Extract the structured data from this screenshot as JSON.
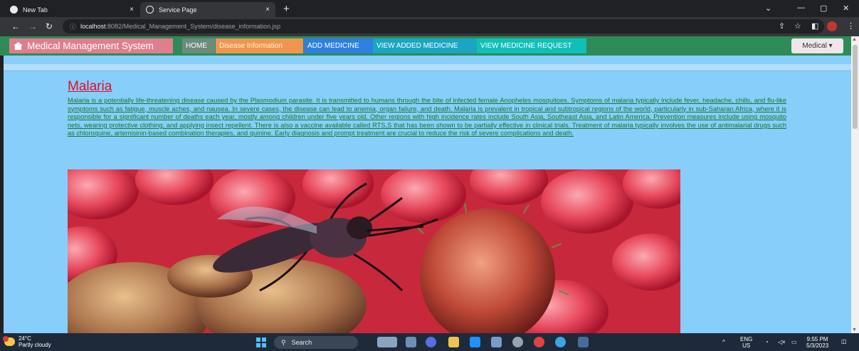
{
  "browser": {
    "tabs": [
      {
        "label": "New Tab"
      },
      {
        "label": "Service Page"
      }
    ],
    "new_tab_glyph": "+",
    "close_glyph": "×",
    "url_host": "localhost",
    "url_rest": ":8082/Medical_Management_System/disease_information.jsp"
  },
  "app": {
    "brand": "Medical Management System",
    "nav": [
      "HOME",
      "Disease Information",
      "ADD MEDICINE",
      "VIEW ADDED MEDICINE",
      "VIEW MEDICINE REQUEST"
    ],
    "dropdown": "Medical ▾"
  },
  "article": {
    "title": "Malaria",
    "body": "Malaria is a potentially life-threatening disease caused by the Plasmodium parasite. It is transmitted to humans through the bite of infected female Anopheles mosquitoes. Symptoms of malaria typically include fever, headache, chills, and flu-like symptoms such as fatigue, muscle aches, and nausea. In severe cases, the disease can lead to anemia, organ failure, and death. Malaria is prevalent in tropical and subtropical regions of the world, particularly in sub-Saharan Africa, where it is responsible for a significant number of deaths each year, mostly among children under five years old. Other regions with high incidence rates include South Asia, Southeast Asia, and Latin America. Prevention measures include using mosquito nets, wearing protective clothing, and applying insect repellent. There is also a vaccine available called RTS,S that has been shown to be partially effective in clinical trials. Treatment of malaria typically involves the use of antimalarial drugs such as chloroquine, artemisinin-based combination therapies, and quinine. Early diagnosis and prompt treatment are crucial to reduce the risk of severe complications and death."
  },
  "taskbar": {
    "temp": "24°C",
    "weather": "Partly cloudy",
    "search": "Search",
    "lang_top": "ENG",
    "lang_bottom": "US",
    "time": "9:55 PM",
    "date": "5/3/2023"
  },
  "colors": {
    "nav_bg": "#2e8b57",
    "content_bg": "#87cefa",
    "title": "#e0102a",
    "body_text": "#127a2e"
  }
}
